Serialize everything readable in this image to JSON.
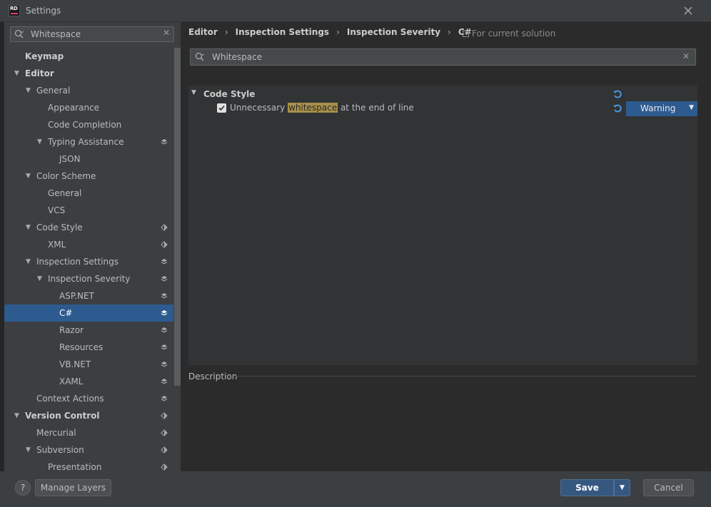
{
  "window": {
    "title": "Settings",
    "app_badge": "RD"
  },
  "sidebar": {
    "search": {
      "value": "Whitespace",
      "placeholder": ""
    },
    "items": [
      {
        "label": "Keymap",
        "depth": 0,
        "expanded": null,
        "bold": true,
        "layer": ""
      },
      {
        "label": "Editor",
        "depth": 0,
        "expanded": true,
        "bold": true,
        "layer": ""
      },
      {
        "label": "General",
        "depth": 1,
        "expanded": true,
        "bold": false,
        "layer": ""
      },
      {
        "label": "Appearance",
        "depth": 2,
        "expanded": null,
        "bold": false,
        "layer": ""
      },
      {
        "label": "Code Completion",
        "depth": 2,
        "expanded": null,
        "bold": false,
        "layer": ""
      },
      {
        "label": "Typing Assistance",
        "depth": 2,
        "expanded": true,
        "bold": false,
        "layer": "stack"
      },
      {
        "label": "JSON",
        "depth": 3,
        "expanded": null,
        "bold": false,
        "layer": ""
      },
      {
        "label": "Color Scheme",
        "depth": 1,
        "expanded": true,
        "bold": false,
        "layer": ""
      },
      {
        "label": "General",
        "depth": 2,
        "expanded": null,
        "bold": false,
        "layer": ""
      },
      {
        "label": "VCS",
        "depth": 2,
        "expanded": null,
        "bold": false,
        "layer": ""
      },
      {
        "label": "Code Style",
        "depth": 1,
        "expanded": true,
        "bold": false,
        "layer": "half"
      },
      {
        "label": "XML",
        "depth": 2,
        "expanded": null,
        "bold": false,
        "layer": "half"
      },
      {
        "label": "Inspection Settings",
        "depth": 1,
        "expanded": true,
        "bold": false,
        "layer": "stack"
      },
      {
        "label": "Inspection Severity",
        "depth": 2,
        "expanded": true,
        "bold": false,
        "layer": "stack"
      },
      {
        "label": "ASP.NET",
        "depth": 3,
        "expanded": null,
        "bold": false,
        "layer": "stack"
      },
      {
        "label": "C#",
        "depth": 3,
        "expanded": null,
        "bold": false,
        "layer": "stack",
        "selected": true
      },
      {
        "label": "Razor",
        "depth": 3,
        "expanded": null,
        "bold": false,
        "layer": "stack"
      },
      {
        "label": "Resources",
        "depth": 3,
        "expanded": null,
        "bold": false,
        "layer": "stack"
      },
      {
        "label": "VB.NET",
        "depth": 3,
        "expanded": null,
        "bold": false,
        "layer": "stack"
      },
      {
        "label": "XAML",
        "depth": 3,
        "expanded": null,
        "bold": false,
        "layer": "stack"
      },
      {
        "label": "Context Actions",
        "depth": 1,
        "expanded": null,
        "bold": false,
        "layer": "stack"
      },
      {
        "label": "Version Control",
        "depth": 0,
        "expanded": true,
        "bold": true,
        "layer": "half"
      },
      {
        "label": "Mercurial",
        "depth": 1,
        "expanded": null,
        "bold": false,
        "layer": "half"
      },
      {
        "label": "Subversion",
        "depth": 1,
        "expanded": true,
        "bold": false,
        "layer": "half"
      },
      {
        "label": "Presentation",
        "depth": 2,
        "expanded": null,
        "bold": false,
        "layer": "half"
      }
    ]
  },
  "breadcrumb": [
    "Editor",
    "Inspection Settings",
    "Inspection Severity",
    "C#"
  ],
  "for_solution": "For current solution",
  "main_search": {
    "value": "Whitespace",
    "placeholder": ""
  },
  "inspections": {
    "group": {
      "label": "Code Style"
    },
    "item": {
      "prefix": "Unnecessary ",
      "match": "whitespace",
      "suffix": " at the end of line",
      "checked": true,
      "severity": "Warning"
    }
  },
  "description": {
    "label": "Description"
  },
  "buttons": {
    "help": "?",
    "manage_layers": "Manage Layers",
    "save": "Save",
    "cancel": "Cancel"
  },
  "colors": {
    "accent": "#2d5b8f",
    "highlight": "#a8904a",
    "primary_button": "#365880"
  },
  "icons": {
    "search": "search-icon",
    "clear": "clear-icon",
    "reset": "reset-icon",
    "layer": "layer-icon",
    "close": "close-icon",
    "dropdown": "chevron-down-icon"
  }
}
